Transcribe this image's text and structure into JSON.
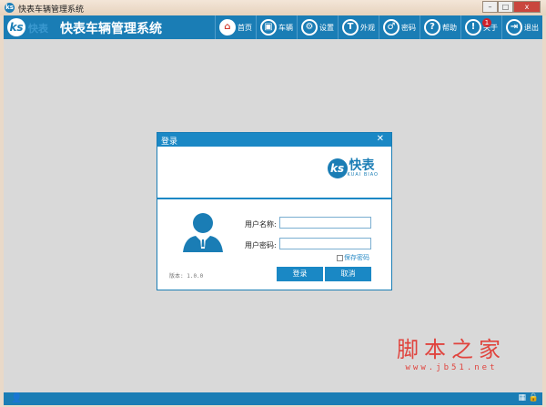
{
  "window": {
    "title": "快表车辆管理系统",
    "minimize": "–",
    "maximize": "□",
    "close": "x"
  },
  "header": {
    "logo": "ks",
    "logo_text": "快表",
    "title": "快表车辆管理系统",
    "nav": [
      {
        "label": "首页",
        "icon": "⌂"
      },
      {
        "label": "车辆",
        "icon": "▣"
      },
      {
        "label": "设置",
        "icon": "⚙"
      },
      {
        "label": "外观",
        "icon": "T"
      },
      {
        "label": "密码",
        "icon": "♂"
      },
      {
        "label": "帮助",
        "icon": "?"
      },
      {
        "label": "关于",
        "icon": "!",
        "badge": "1"
      },
      {
        "label": "退出",
        "icon": "⇥"
      }
    ]
  },
  "dialog": {
    "title": "登录",
    "close": "✕",
    "logo_mark": "ks",
    "logo_cn": "快表",
    "logo_en": "KUAI BIAO",
    "username_label": "用户名称:",
    "username_value": "",
    "password_label": "用户密码:",
    "password_value": "",
    "remember": "保存密码",
    "version": "版本: 1.0.0",
    "login": "登录",
    "cancel": "取消"
  },
  "watermark": {
    "cn": "脚本之家",
    "url": "www.jb51.net"
  },
  "status": {
    "user_icon": "👤",
    "grid_icon": "▦",
    "lock_icon": "🔒"
  },
  "colors": {
    "brand": "#1a7db5",
    "watermark": "#e0443e"
  }
}
